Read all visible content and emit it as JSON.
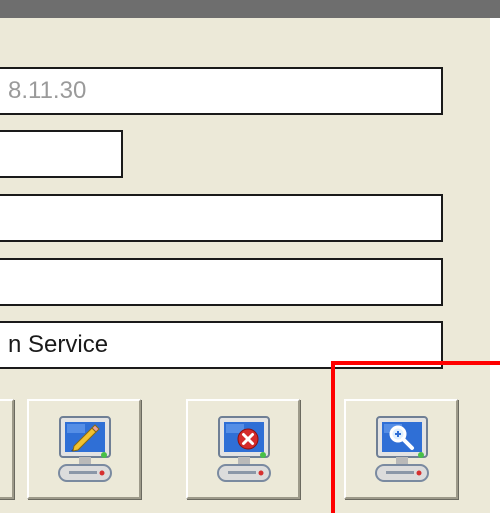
{
  "form": {
    "field1_value": "8.11.30",
    "field2_value": "",
    "field3_value": "",
    "field4_value": "",
    "field5_value": "n Service"
  },
  "toolbar": {
    "buttons": [
      {
        "icon": "monitor-icon"
      },
      {
        "icon": "monitor-edit-icon"
      },
      {
        "icon": "monitor-delete-icon"
      },
      {
        "icon": "monitor-search-icon"
      }
    ]
  },
  "highlight": {
    "color": "#ff0000",
    "target": "monitor-search-button"
  },
  "colors": {
    "panel": "#ece9d8",
    "titlebar": "#6e6e6e"
  }
}
